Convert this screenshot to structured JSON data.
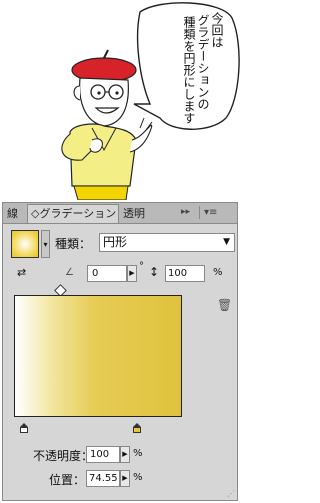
{
  "speech_bubble": {
    "columns": [
      "今回は",
      "グラデーションの",
      "種類を円形にします"
    ]
  },
  "panel": {
    "tabs": [
      {
        "label": "線"
      },
      {
        "label": "◇グラデーション"
      },
      {
        "label": "透明"
      }
    ],
    "collapse_icon": "▸▸",
    "menu_icon": "▾≡",
    "type_label": "種類：",
    "type_value": "円形",
    "angle_value": "0",
    "degree_symbol": "°",
    "aspect_value": "100",
    "aspect_unit": "%",
    "opacity_label": "不透明度：",
    "opacity_value": "100",
    "opacity_unit": "%",
    "location_label": "位置：",
    "location_value": "74.55",
    "location_unit": "%",
    "colors": {
      "gradient_start": "#ffffff",
      "gradient_end": "#dfc23c"
    }
  }
}
